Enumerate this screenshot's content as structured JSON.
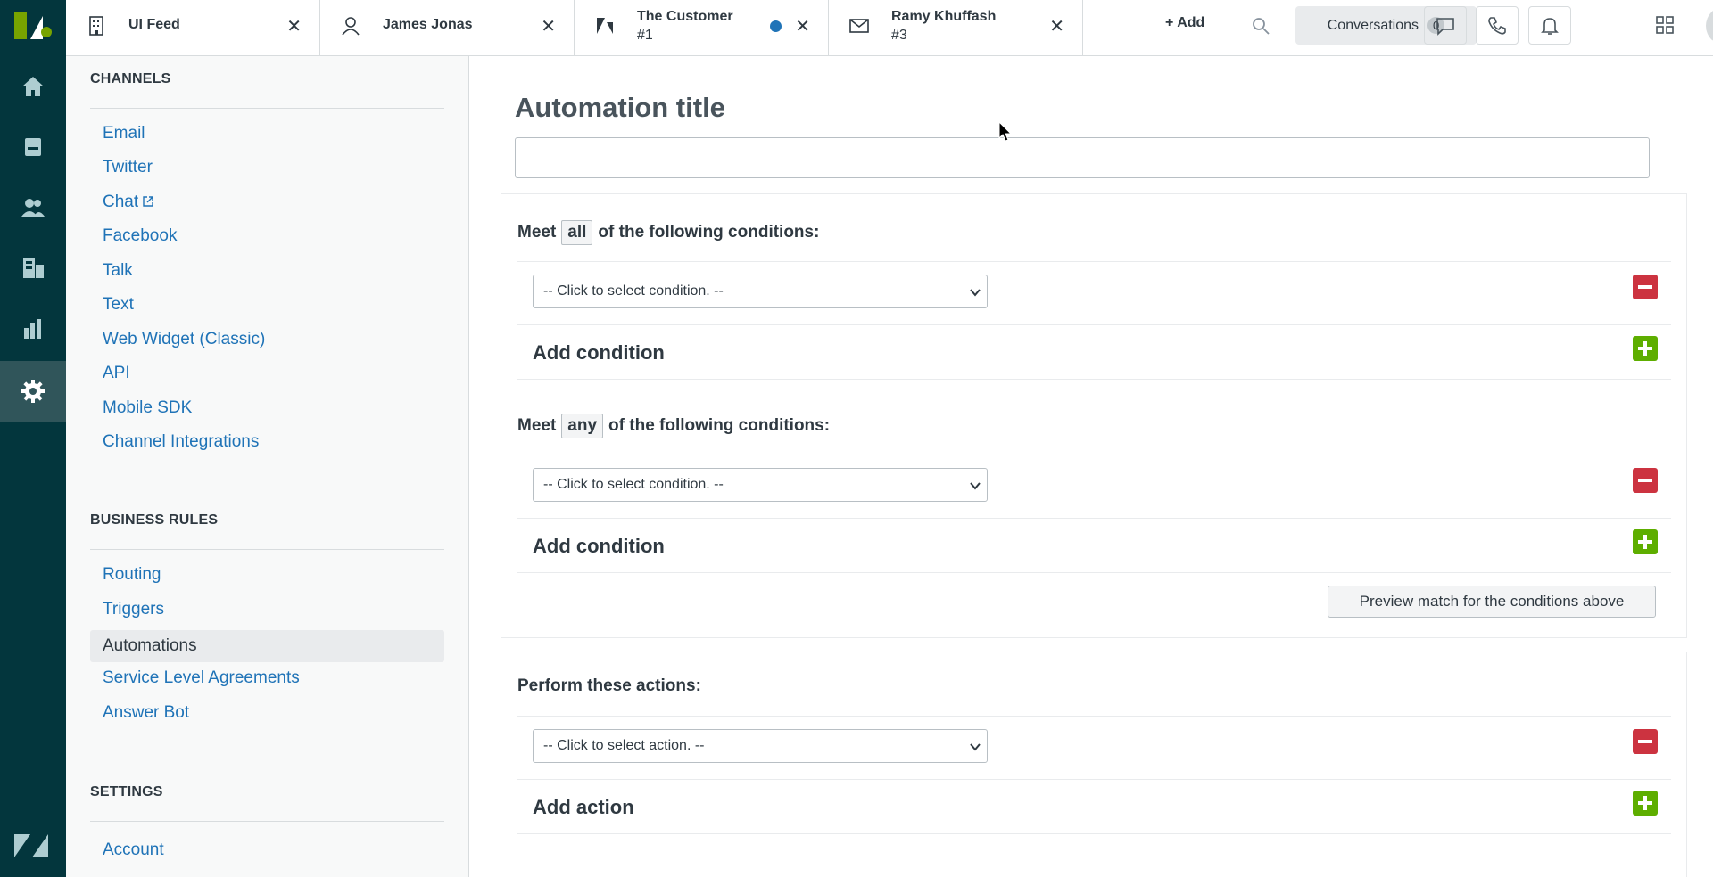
{
  "tabs": [
    {
      "title": "UI Feed",
      "subtitle": "",
      "icon": "building-icon"
    },
    {
      "title": "James Jonas",
      "subtitle": "",
      "icon": "user-icon"
    },
    {
      "title": "The Customer",
      "subtitle": "#1",
      "icon": "ticket-icon",
      "unread_dot": true
    },
    {
      "title": "Ramy Khuffash",
      "subtitle": "#3",
      "icon": "mail-icon"
    }
  ],
  "topbar": {
    "add_label": "+ Add",
    "conversations_label": "Conversations",
    "conversations_count": "0"
  },
  "sidebar": {
    "channels_heading": "CHANNELS",
    "channels": [
      "Email",
      "Twitter",
      "Chat",
      "Facebook",
      "Talk",
      "Text",
      "Web Widget (Classic)",
      "API",
      "Mobile SDK",
      "Channel Integrations"
    ],
    "business_rules_heading": "BUSINESS RULES",
    "business_rules": [
      "Routing",
      "Triggers",
      "Automations",
      "Service Level Agreements",
      "Answer Bot"
    ],
    "active_item": "Automations",
    "settings_heading": "SETTINGS",
    "settings": [
      "Account"
    ]
  },
  "form": {
    "title_label": "Automation title",
    "title_value": "",
    "all_block": {
      "prefix": "Meet",
      "keyword": "all",
      "suffix": "of the following conditions:",
      "select_placeholder": "-- Click to select condition. --",
      "add_label": "Add condition"
    },
    "any_block": {
      "prefix": "Meet",
      "keyword": "any",
      "suffix": "of the following conditions:",
      "select_placeholder": "-- Click to select condition. --",
      "add_label": "Add condition"
    },
    "preview_button": "Preview match for the conditions above",
    "actions_block": {
      "heading": "Perform these actions:",
      "select_placeholder": "-- Click to select action. --",
      "add_label": "Add action"
    }
  },
  "colors": {
    "nav_bg": "#03363d",
    "link": "#1f73b7",
    "remove": "#cc3340",
    "add": "#5eae00"
  }
}
